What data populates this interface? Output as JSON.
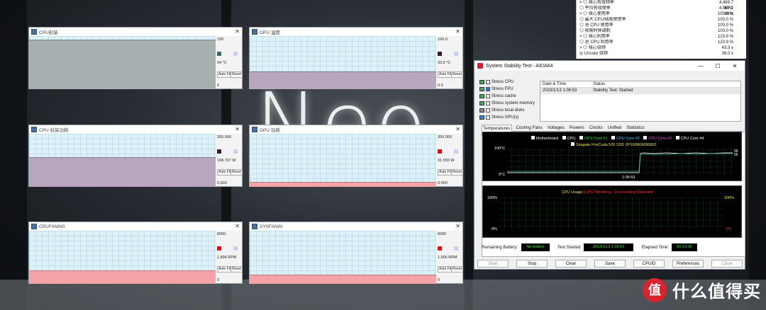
{
  "monitors": [
    {
      "title": "CPU封装",
      "max": "100",
      "value": "94 °C",
      "min": "0",
      "level": 0.94,
      "fill": "#a7b0b0",
      "swatch": "#3a6e6e"
    },
    {
      "title": "GPU 温度",
      "max": "100.0",
      "value": "33.5 °C",
      "min": "0.0",
      "level": 0.335,
      "fill": "#b7a6bd",
      "swatch": "#3a1a3a"
    },
    {
      "title": "CPU 封装功耗",
      "max": "300.000",
      "value": "168.707 W",
      "min": "0.000",
      "level": 0.56,
      "fill": "#b7a6bd",
      "swatch": "#3a1a3a"
    },
    {
      "title": "GPU 功耗",
      "max": "300.000",
      "value": "31.555 W",
      "min": "0.000",
      "level": 0.1,
      "fill": "#f4a3a8",
      "swatch": "#e01010"
    },
    {
      "title": "CPUFANIN0",
      "max": "6000",
      "value": "1,896 RPM",
      "min": "0",
      "level": 0.25,
      "fill": "#f4a3a8",
      "swatch": "#e01010"
    },
    {
      "title": "SYSFANIN",
      "max": "6000",
      "value": "1,566 RPM",
      "min": "0",
      "level": 0.18,
      "fill": "#f4a3a8",
      "swatch": "#e01010"
    }
  ],
  "monitor_buttons": {
    "autofit": "Auto Fit",
    "reset": "Reset"
  },
  "sensors": [
    {
      "k": "> ◎ 核心有效频率",
      "v": "4,469.7 MHz"
    },
    {
      "k": "◎ 平均有效频率",
      "v": "4,567.2 MHz"
    },
    {
      "k": "> ◎ 核心使用率",
      "v": "100.0 %"
    },
    {
      "k": "◎ 最大 CPU/线程使用率",
      "v": "100.0 %"
    },
    {
      "k": "◎ 总 CPU 使用率",
      "v": "100.0 %"
    },
    {
      "k": "◎ 按需时钟调制",
      "v": "100.0 %"
    },
    {
      "k": "> ◎ 核心利用率",
      "v": "123.9 %"
    },
    {
      "k": "◎ 总 CPU 利用率",
      "v": "123.9 %"
    },
    {
      "k": "> ◎ 核心倍频",
      "v": "43.3 x"
    },
    {
      "k": "◎ Uncore 倍频",
      "v": "36.0 x"
    }
  ],
  "aida": {
    "title": "System Stability Test - AIDA64",
    "win_buttons": [
      "—",
      "☐",
      "✕"
    ],
    "stress": [
      {
        "label": "Stress CPU",
        "on": false
      },
      {
        "label": "Stress FPU",
        "on": true
      },
      {
        "label": "Stress cache",
        "on": false
      },
      {
        "label": "Stress system memory",
        "on": false
      },
      {
        "label": "Stress local disks",
        "on": false
      },
      {
        "label": "Stress GPU(s)",
        "on": false
      }
    ],
    "status_headers": {
      "date": "Date & Time",
      "status": "Status"
    },
    "status_row": {
      "date": "2023/1/13 1:06:53",
      "status": "Stability Test: Started"
    },
    "tabs": [
      "Temperatures",
      "Cooling Fans",
      "Voltages",
      "Powers",
      "Clocks",
      "Unified",
      "Statistics"
    ],
    "legend": [
      "Motherboard",
      "CPU",
      "CPU Core #1",
      "CPU Core #2",
      "CPU Core #3",
      "CPU Core #4"
    ],
    "legend2": "Seagate FireCuda 520 SSD ZP1000GM30002",
    "temp_top": "100°C",
    "temp_bot": "0°C",
    "temp_time": "1:06:53",
    "temp_right": "96",
    "temp_right2": "95",
    "usage_title": "CPU Usage",
    "usage_sep": "|",
    "usage_throttle": "CPU Throttling - Overheating Detected!",
    "usage_top_left": "100%",
    "usage_bot_left": "0%",
    "usage_top_right": "100%",
    "usage_bot_right": "0%",
    "battery_label": "Remaining Battery:",
    "battery_value": "No battery",
    "started_label": "Test Started:",
    "started_value": "2023/1/13 1:06:53",
    "elapsed_label": "Elapsed Time:",
    "elapsed_value": "00:10:05",
    "buttons": [
      "Start",
      "Stop",
      "Clear",
      "Save",
      "CPUID",
      "Preferences",
      "Close"
    ]
  },
  "watermark": {
    "logo": "值",
    "text": "什么值得买"
  }
}
